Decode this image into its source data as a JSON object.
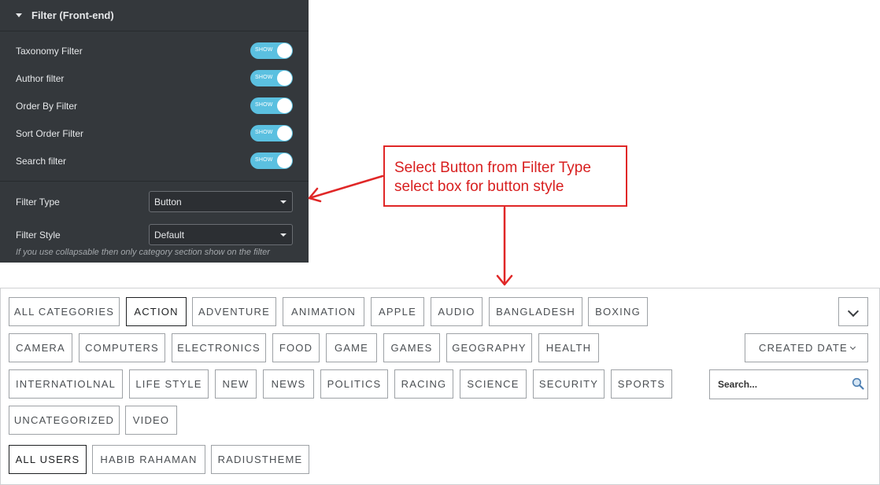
{
  "panel": {
    "title": "Filter (Front-end)",
    "toggles": [
      {
        "label": "Taxonomy Filter",
        "state": "SHOW"
      },
      {
        "label": "Author filter",
        "state": "SHOW"
      },
      {
        "label": "Order By Filter",
        "state": "SHOW"
      },
      {
        "label": "Sort Order Filter",
        "state": "SHOW"
      },
      {
        "label": "Search filter",
        "state": "SHOW"
      }
    ],
    "filter_type": {
      "label": "Filter Type",
      "value": "Button"
    },
    "filter_style": {
      "label": "Filter Style",
      "value": "Default"
    },
    "note": "If you use collapsable then only category section show on the filter"
  },
  "callout": {
    "line1": "Select Button from Filter Type",
    "line2": "select box for button style",
    "color": "#e02727"
  },
  "preview": {
    "categories": [
      "ALL CATEGORIES",
      "ACTION",
      "ADVENTURE",
      "ANIMATION",
      "APPLE",
      "AUDIO",
      "BANGLADESH",
      "BOXING",
      "CAMERA",
      "COMPUTERS",
      "ELECTRONICS",
      "FOOD",
      "GAME",
      "GAMES",
      "GEOGRAPHY",
      "HEALTH",
      "INTERNATIOLNAL",
      "LIFE STYLE",
      "NEW",
      "NEWS",
      "POLITICS",
      "RACING",
      "SCIENCE",
      "SECURITY",
      "SPORTS",
      "UNCATEGORIZED",
      "VIDEO"
    ],
    "active_category": "ACTION",
    "users": [
      "ALL USERS",
      "HABIB RAHAMAN",
      "RADIUSTHEME"
    ],
    "active_user": "ALL USERS",
    "order_by": "CREATED DATE",
    "search_placeholder": "Search..."
  },
  "colors": {
    "panel_bg": "#34383c",
    "switch_on": "#5bc0e0",
    "annotation": "#e02727"
  }
}
